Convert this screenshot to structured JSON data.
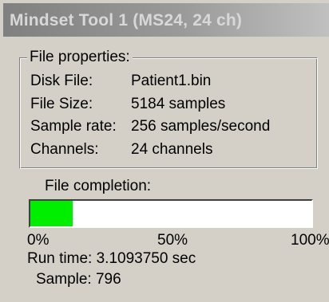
{
  "window": {
    "title": "Mindset Tool 1  (MS24, 24 ch)"
  },
  "file_properties": {
    "legend": "File properties:",
    "rows": [
      {
        "label": "Disk File:",
        "value": "Patient1.bin"
      },
      {
        "label": "File Size:",
        "value": "5184 samples"
      },
      {
        "label": "Sample rate:",
        "value": "256 samples/second"
      },
      {
        "label": "Channels:",
        "value": "24 channels"
      }
    ]
  },
  "completion": {
    "label": "File completion:",
    "progress_fraction": 0.15,
    "fill_color": "#00ee00",
    "scale": {
      "min": "0%",
      "mid": "50%",
      "max": "100%"
    }
  },
  "status": {
    "run_time_label": "Run time:",
    "run_time_value": "3.1093750 sec",
    "sample_label": "Sample:",
    "sample_value": "796"
  }
}
